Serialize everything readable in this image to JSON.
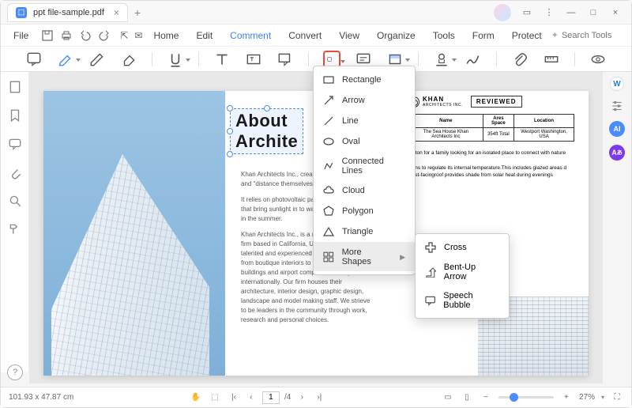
{
  "window": {
    "tab_title": "ppt file-sample.pdf"
  },
  "menubar": {
    "file": "File",
    "items": [
      "Home",
      "Edit",
      "Comment",
      "Convert",
      "View",
      "Organize",
      "Tools",
      "Form",
      "Protect"
    ],
    "active_index": 2,
    "search_placeholder": "Search Tools"
  },
  "shape_menu": {
    "items": [
      {
        "icon": "rectangle",
        "label": "Rectangle"
      },
      {
        "icon": "arrow",
        "label": "Arrow"
      },
      {
        "icon": "line",
        "label": "Line"
      },
      {
        "icon": "oval",
        "label": "Oval"
      },
      {
        "icon": "connected",
        "label": "Connected Lines"
      },
      {
        "icon": "cloud",
        "label": "Cloud"
      },
      {
        "icon": "polygon",
        "label": "Polygon"
      },
      {
        "icon": "triangle",
        "label": "Triangle"
      }
    ],
    "more_label": "More Shapes",
    "submenu": [
      {
        "icon": "cross",
        "label": "Cross"
      },
      {
        "icon": "bentarrow",
        "label": "Bent-Up Arrow"
      },
      {
        "icon": "speech",
        "label": "Speech Bubble"
      }
    ]
  },
  "document": {
    "headline_line1": "About",
    "headline_line2": "Archite",
    "para1": "Khan Architects Inc., createc",
    "para1b": "and \"distance themselves fr",
    "para2": "It relies on photovoltaic pane",
    "para2b": "that bring sunlight in to warr",
    "para2c": "in the summer.",
    "para3": "Khan Architects Inc., is a mid-size architecture firm based in California, USA. Our exceptionally talented and experienced staff work on projects from boutique interiors to large institutional buildings and airport complexes, locally and internationally. Our firm houses their architecture, interior design, graphic design, landscape and model making staff. We strieve to be leaders in the community through work, research and personal choices.",
    "khan_name": "KHAN",
    "khan_sub": "ARCHITECTS INC.",
    "reviewed": "REVIEWED",
    "table": {
      "h1": "Name",
      "h2": "Ares Space",
      "h3": "Location",
      "v1": "The Sea House Khan Architects Inc",
      "v2": "354ft Total",
      "v3": "Westport Washington, USA"
    },
    "col2_p1": "ington for a family looking for an isolated place to connect with nature",
    "col2_p2": "signs to regulate its internal temperature.This includes glazed areas d west-facingroof provides shade from solar heat during evenings"
  },
  "status": {
    "coords": "101.93 x 47.87 cm",
    "page_current": "1",
    "page_total": "/4",
    "zoom": "27%"
  }
}
